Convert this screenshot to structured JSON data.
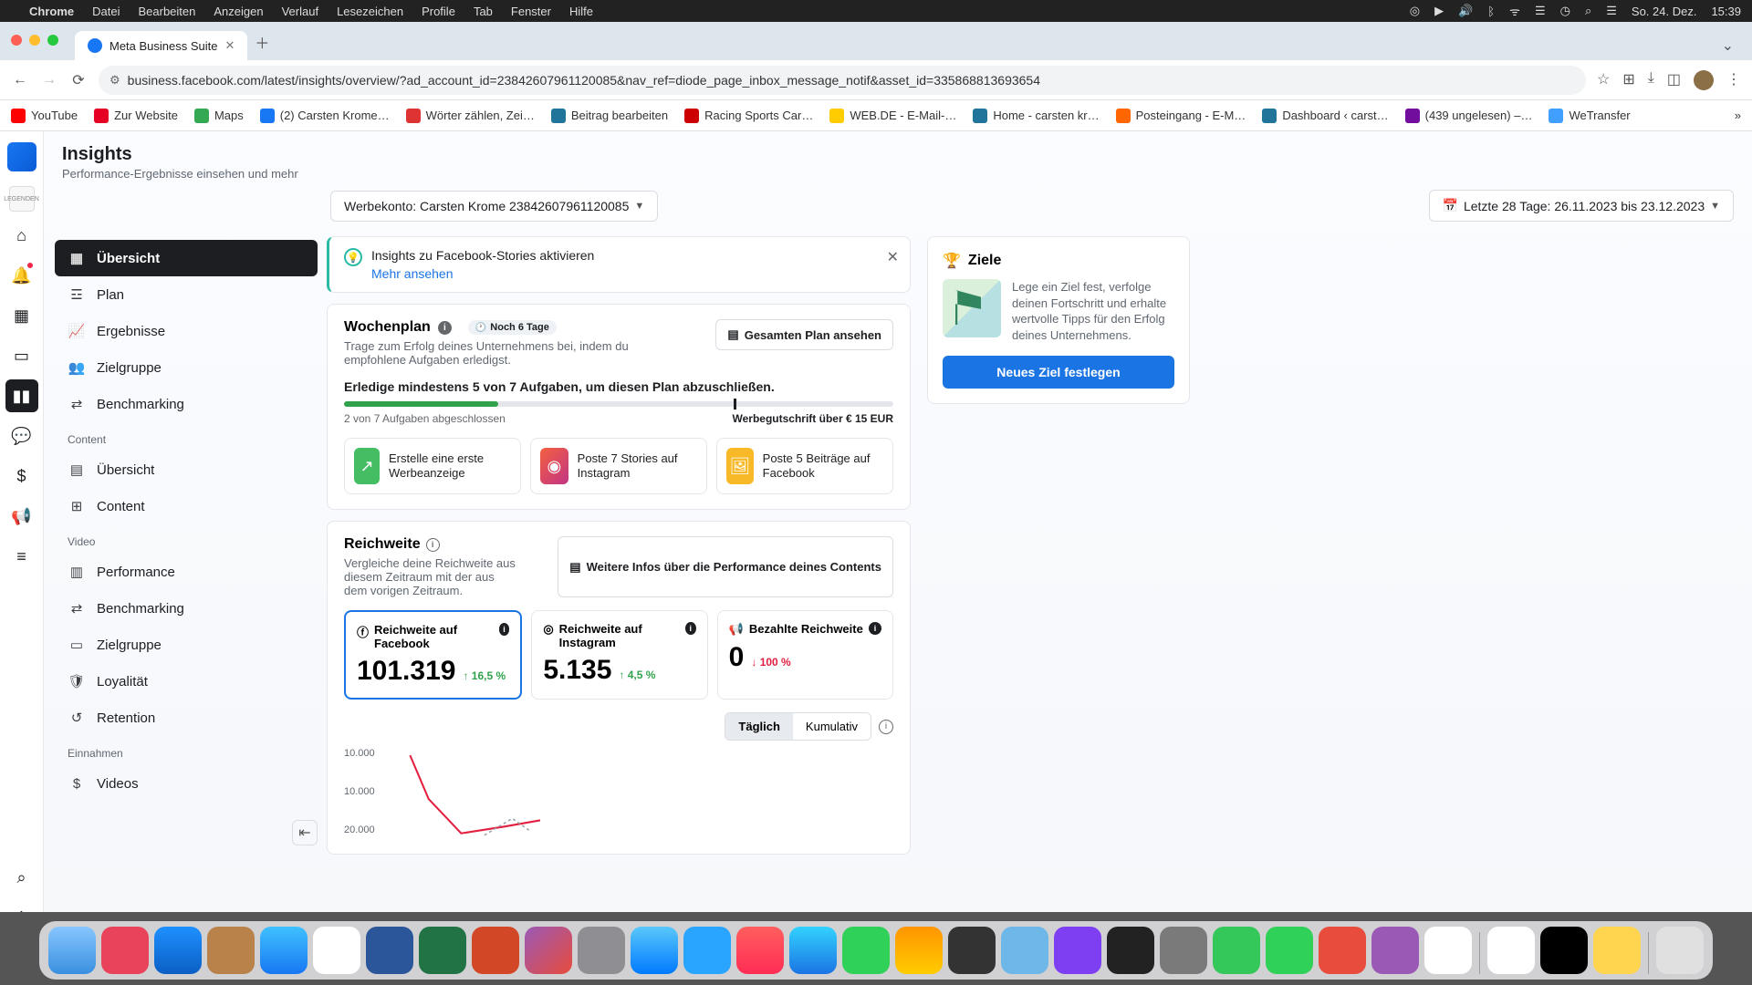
{
  "macos": {
    "app": "Chrome",
    "menus": [
      "Datei",
      "Bearbeiten",
      "Anzeigen",
      "Verlauf",
      "Lesezeichen",
      "Profile",
      "Tab",
      "Fenster",
      "Hilfe"
    ],
    "date": "So. 24. Dez.",
    "time": "15:39"
  },
  "chrome": {
    "tab_title": "Meta Business Suite",
    "url": "business.facebook.com/latest/insights/overview/?ad_account_id=23842607961120085&nav_ref=diode_page_inbox_message_notif&asset_id=335868813693654",
    "bookmarks": [
      "YouTube",
      "Zur Website",
      "Maps",
      "(2) Carsten Krome…",
      "Wörter zählen, Zei…",
      "Beitrag bearbeiten",
      "Racing Sports Car…",
      "WEB.DE - E-Mail-…",
      "Home - carsten kr…",
      "Posteingang - E-M…",
      "Dashboard ‹ carst…",
      "(439 ungelesen) –…",
      "WeTransfer"
    ]
  },
  "page": {
    "title": "Insights",
    "subtitle": "Performance-Ergebnisse einsehen und mehr",
    "account_pill": "Werbekonto: Carsten Krome 23842607961120085",
    "date_pill": "Letzte 28 Tage: 26.11.2023 bis 23.12.2023"
  },
  "side_nav": {
    "items": [
      "Übersicht",
      "Plan",
      "Ergebnisse",
      "Zielgruppe",
      "Benchmarking"
    ],
    "sec_content": "Content",
    "content_items": [
      "Übersicht",
      "Content"
    ],
    "sec_video": "Video",
    "video_items": [
      "Performance",
      "Benchmarking",
      "Zielgruppe",
      "Loyalität",
      "Retention"
    ],
    "sec_einnahmen": "Einnahmen",
    "einnahmen_items": [
      "Videos"
    ]
  },
  "banner": {
    "text": "Insights zu Facebook-Stories aktivieren",
    "link": "Mehr ansehen"
  },
  "wochenplan": {
    "title": "Wochenplan",
    "badge": "Noch 6 Tage",
    "desc": "Trage zum Erfolg deines Unternehmens bei, indem du empfohlene Aufgaben erledigst.",
    "view_all": "Gesamten Plan ansehen",
    "goal": "Erledige mindestens 5 von 7 Aufgaben, um diesen Plan abzuschließen.",
    "progress_text": "2 von 7 Aufgaben abgeschlossen",
    "credit_text": "Werbegutschrift über € 15 EUR",
    "tasks": [
      "Erstelle eine erste Werbeanzeige",
      "Poste 7 Stories auf Instagram",
      "Poste 5 Beiträge auf Facebook"
    ]
  },
  "reach": {
    "title": "Reichweite",
    "desc": "Vergleiche deine Reichweite aus diesem Zeitraum mit der aus dem vorigen Zeitraum.",
    "more_btn": "Weitere Infos über die Performance deines Contents",
    "metrics": [
      {
        "label": "Reichweite auf Facebook",
        "value": "101.319",
        "delta": "16,5 %",
        "dir": "up"
      },
      {
        "label": "Reichweite auf Instagram",
        "value": "5.135",
        "delta": "4,5 %",
        "dir": "up"
      },
      {
        "label": "Bezahlte Reichweite",
        "value": "0",
        "delta": "100 %",
        "dir": "down"
      }
    ],
    "seg_daily": "Täglich",
    "seg_cum": "Kumulativ",
    "y_ticks": [
      "10.000",
      "10.000",
      "20.000"
    ]
  },
  "goals": {
    "title": "Ziele",
    "desc": "Lege ein Ziel fest, verfolge deinen Fortschritt und erhalte wertvolle Tipps für den Erfolg deines Unternehmens.",
    "button": "Neues Ziel festlegen"
  }
}
